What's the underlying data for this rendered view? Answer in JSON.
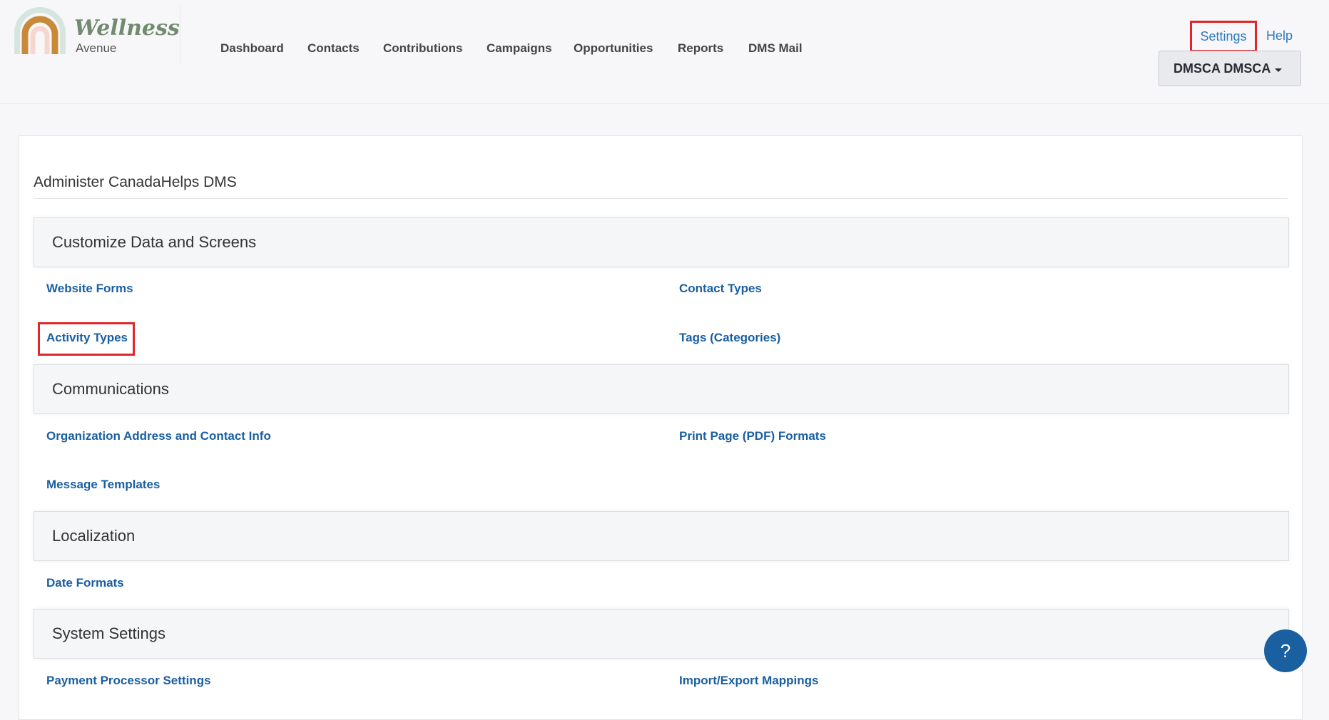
{
  "brand": {
    "name": "Wellness",
    "sub": "Avenue"
  },
  "nav": [
    "Dashboard",
    "Contacts",
    "Contributions",
    "Campaigns",
    "Opportunities",
    "Reports",
    "DMS Mail"
  ],
  "top": {
    "settings": "Settings",
    "help": "Help",
    "user": "DMSCA DMSCA"
  },
  "page_title": "Administer CanadaHelps DMS",
  "sections": [
    {
      "title": "Customize Data and Screens",
      "links": [
        "Website Forms",
        "Contact Types",
        "Activity Types",
        "Tags (Categories)"
      ]
    },
    {
      "title": "Communications",
      "links": [
        "Organization Address and Contact Info",
        "Print Page (PDF) Formats",
        "Message Templates"
      ]
    },
    {
      "title": "Localization",
      "links": [
        "Date Formats"
      ]
    },
    {
      "title": "System Settings",
      "links": [
        "Payment Processor Settings",
        "Import/Export Mappings"
      ]
    }
  ],
  "help_button": "?"
}
